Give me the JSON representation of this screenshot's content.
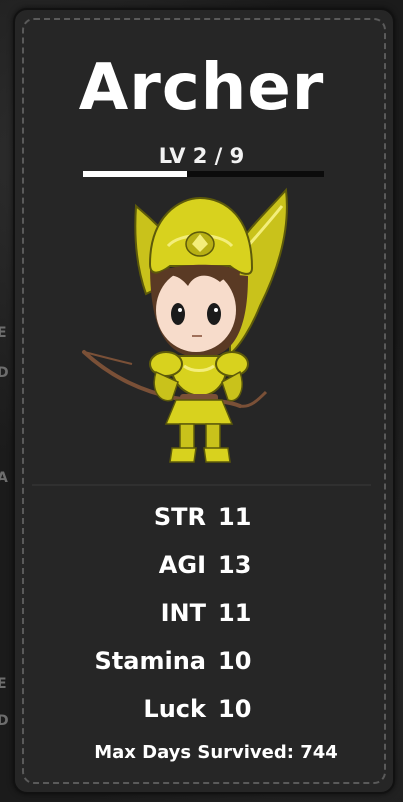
{
  "character": {
    "name": "Archer",
    "level_text": "LV 2 / 9",
    "level_progress": 0.43,
    "portrait": "archer-portrait"
  },
  "stats": [
    {
      "label": "STR",
      "value": "11"
    },
    {
      "label": "AGI",
      "value": "13"
    },
    {
      "label": "INT",
      "value": "11"
    },
    {
      "label": "Stamina",
      "value": "10"
    },
    {
      "label": "Luck",
      "value": "10"
    }
  ],
  "footer": {
    "max_days": "Max Days Survived: 744"
  },
  "background_edge_letters": [
    "E",
    "D",
    "A",
    "E",
    "D"
  ],
  "colors": {
    "card": "#262626",
    "armor": "#d8d21e",
    "text": "#ffffff"
  }
}
